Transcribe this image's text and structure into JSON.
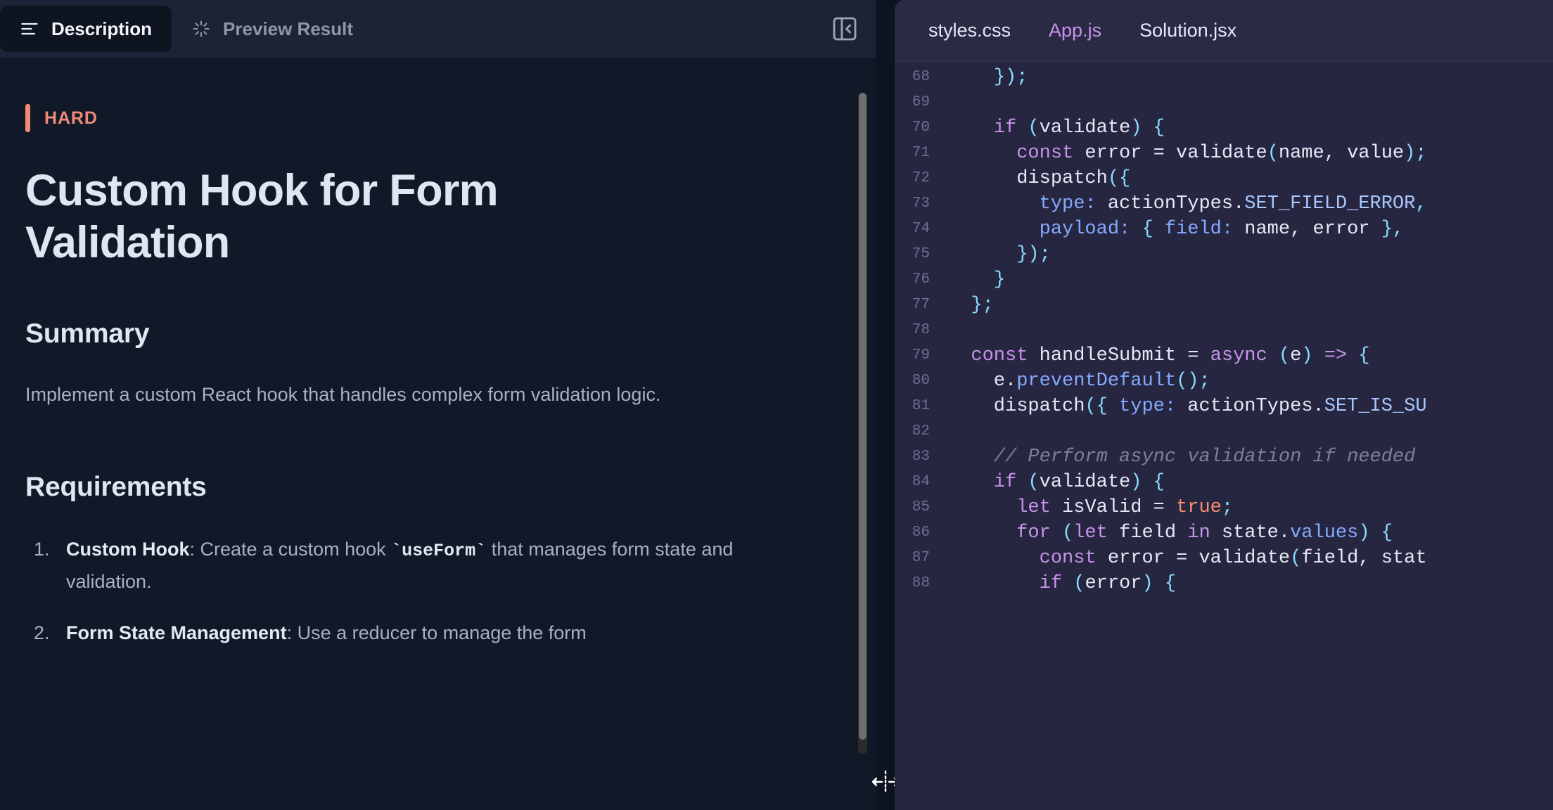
{
  "left_panel": {
    "tabs": [
      {
        "label": "Description",
        "icon": "align-left-icon",
        "active": true
      },
      {
        "label": "Preview Result",
        "icon": "sparkle-wand-icon",
        "active": false
      }
    ],
    "collapse_icon": "panel-collapse-left-icon",
    "difficulty_badge": "HARD",
    "difficulty_color": "#f08a77",
    "title": "Custom Hook for Form Validation",
    "summary_heading": "Summary",
    "summary_text": "Implement a custom React hook that handles complex form validation logic.",
    "requirements_heading": "Requirements",
    "requirements": [
      {
        "number": "1.",
        "term": "Custom Hook",
        "sep": ": ",
        "text_before": "Create a custom hook ",
        "code": "`useForm`",
        "text_after": " that manages form state and validation."
      },
      {
        "number": "2.",
        "term": "Form State Management",
        "sep": ": ",
        "text_before": "Use a reducer to manage the form",
        "code": "",
        "text_after": ""
      }
    ]
  },
  "splitter": {
    "cursor_icon": "horizontal-resize-cursor"
  },
  "right_panel": {
    "tabs": [
      {
        "label": "styles.css",
        "active": false
      },
      {
        "label": "App.js",
        "active": true
      },
      {
        "label": "Solution.jsx",
        "active": false
      }
    ],
    "active_tab_color": "#c792ea",
    "code_lines": [
      {
        "num": "68",
        "tokens": [
          {
            "t": "    ",
            "c": "tk-var"
          },
          {
            "t": "});",
            "c": "tk-punc"
          }
        ]
      },
      {
        "num": "69",
        "tokens": [
          {
            "t": "",
            "c": "tk-var"
          }
        ]
      },
      {
        "num": "70",
        "tokens": [
          {
            "t": "    ",
            "c": "tk-var"
          },
          {
            "t": "if",
            "c": "tk-kw"
          },
          {
            "t": " ",
            "c": "tk-var"
          },
          {
            "t": "(",
            "c": "tk-punc"
          },
          {
            "t": "validate",
            "c": "tk-var"
          },
          {
            "t": ")",
            "c": "tk-punc"
          },
          {
            "t": " ",
            "c": "tk-var"
          },
          {
            "t": "{",
            "c": "tk-punc"
          }
        ]
      },
      {
        "num": "71",
        "tokens": [
          {
            "t": "      ",
            "c": "tk-var"
          },
          {
            "t": "const",
            "c": "tk-kw"
          },
          {
            "t": " error = validate",
            "c": "tk-var"
          },
          {
            "t": "(",
            "c": "tk-punc"
          },
          {
            "t": "name, value",
            "c": "tk-var"
          },
          {
            "t": ");",
            "c": "tk-punc"
          }
        ]
      },
      {
        "num": "72",
        "tokens": [
          {
            "t": "      dispatch",
            "c": "tk-var"
          },
          {
            "t": "({",
            "c": "tk-punc"
          }
        ]
      },
      {
        "num": "73",
        "tokens": [
          {
            "t": "        ",
            "c": "tk-var"
          },
          {
            "t": "type:",
            "c": "tk-prop"
          },
          {
            "t": " actionTypes.",
            "c": "tk-var"
          },
          {
            "t": "SET_FIELD_ERROR",
            "c": "tk-cap"
          },
          {
            "t": ",",
            "c": "tk-punc"
          }
        ]
      },
      {
        "num": "74",
        "tokens": [
          {
            "t": "        ",
            "c": "tk-var"
          },
          {
            "t": "payload:",
            "c": "tk-prop"
          },
          {
            "t": " ",
            "c": "tk-var"
          },
          {
            "t": "{",
            "c": "tk-punc"
          },
          {
            "t": " ",
            "c": "tk-var"
          },
          {
            "t": "field:",
            "c": "tk-prop"
          },
          {
            "t": " name, error ",
            "c": "tk-var"
          },
          {
            "t": "},",
            "c": "tk-punc"
          }
        ]
      },
      {
        "num": "75",
        "tokens": [
          {
            "t": "      ",
            "c": "tk-var"
          },
          {
            "t": "});",
            "c": "tk-punc"
          }
        ]
      },
      {
        "num": "76",
        "tokens": [
          {
            "t": "    ",
            "c": "tk-var"
          },
          {
            "t": "}",
            "c": "tk-punc"
          }
        ]
      },
      {
        "num": "77",
        "tokens": [
          {
            "t": "  ",
            "c": "tk-var"
          },
          {
            "t": "};",
            "c": "tk-punc"
          }
        ]
      },
      {
        "num": "78",
        "tokens": [
          {
            "t": "",
            "c": "tk-var"
          }
        ]
      },
      {
        "num": "79",
        "tokens": [
          {
            "t": "  ",
            "c": "tk-var"
          },
          {
            "t": "const",
            "c": "tk-kw"
          },
          {
            "t": " handleSubmit = ",
            "c": "tk-var"
          },
          {
            "t": "async",
            "c": "tk-kw"
          },
          {
            "t": " ",
            "c": "tk-var"
          },
          {
            "t": "(",
            "c": "tk-punc"
          },
          {
            "t": "e",
            "c": "tk-var"
          },
          {
            "t": ")",
            "c": "tk-punc"
          },
          {
            "t": " ",
            "c": "tk-var"
          },
          {
            "t": "=>",
            "c": "tk-kw"
          },
          {
            "t": " ",
            "c": "tk-var"
          },
          {
            "t": "{",
            "c": "tk-punc"
          }
        ]
      },
      {
        "num": "80",
        "tokens": [
          {
            "t": "    e.",
            "c": "tk-var"
          },
          {
            "t": "preventDefault",
            "c": "tk-fn"
          },
          {
            "t": "();",
            "c": "tk-punc"
          }
        ]
      },
      {
        "num": "81",
        "tokens": [
          {
            "t": "    dispatch",
            "c": "tk-var"
          },
          {
            "t": "({",
            "c": "tk-punc"
          },
          {
            "t": " ",
            "c": "tk-var"
          },
          {
            "t": "type:",
            "c": "tk-prop"
          },
          {
            "t": " actionTypes.",
            "c": "tk-var"
          },
          {
            "t": "SET_IS_SU",
            "c": "tk-cap"
          }
        ]
      },
      {
        "num": "82",
        "tokens": [
          {
            "t": "",
            "c": "tk-var"
          }
        ]
      },
      {
        "num": "83",
        "tokens": [
          {
            "t": "    ",
            "c": "tk-var"
          },
          {
            "t": "// Perform async validation if needed",
            "c": "tk-com"
          }
        ]
      },
      {
        "num": "84",
        "tokens": [
          {
            "t": "    ",
            "c": "tk-var"
          },
          {
            "t": "if",
            "c": "tk-kw"
          },
          {
            "t": " ",
            "c": "tk-var"
          },
          {
            "t": "(",
            "c": "tk-punc"
          },
          {
            "t": "validate",
            "c": "tk-var"
          },
          {
            "t": ")",
            "c": "tk-punc"
          },
          {
            "t": " ",
            "c": "tk-var"
          },
          {
            "t": "{",
            "c": "tk-punc"
          }
        ]
      },
      {
        "num": "85",
        "tokens": [
          {
            "t": "      ",
            "c": "tk-var"
          },
          {
            "t": "let",
            "c": "tk-kw"
          },
          {
            "t": " isValid = ",
            "c": "tk-var"
          },
          {
            "t": "true",
            "c": "tk-const"
          },
          {
            "t": ";",
            "c": "tk-punc"
          }
        ]
      },
      {
        "num": "86",
        "tokens": [
          {
            "t": "      ",
            "c": "tk-var"
          },
          {
            "t": "for",
            "c": "tk-kw"
          },
          {
            "t": " ",
            "c": "tk-var"
          },
          {
            "t": "(",
            "c": "tk-punc"
          },
          {
            "t": "let",
            "c": "tk-kw"
          },
          {
            "t": " field ",
            "c": "tk-var"
          },
          {
            "t": "in",
            "c": "tk-kw"
          },
          {
            "t": " state.",
            "c": "tk-var"
          },
          {
            "t": "values",
            "c": "tk-fn"
          },
          {
            "t": ")",
            "c": "tk-punc"
          },
          {
            "t": " ",
            "c": "tk-var"
          },
          {
            "t": "{",
            "c": "tk-punc"
          }
        ]
      },
      {
        "num": "87",
        "tokens": [
          {
            "t": "        ",
            "c": "tk-var"
          },
          {
            "t": "const",
            "c": "tk-kw"
          },
          {
            "t": " error = validate",
            "c": "tk-var"
          },
          {
            "t": "(",
            "c": "tk-punc"
          },
          {
            "t": "field, stat",
            "c": "tk-var"
          }
        ]
      },
      {
        "num": "88",
        "tokens": [
          {
            "t": "        ",
            "c": "tk-var"
          },
          {
            "t": "if",
            "c": "tk-kw"
          },
          {
            "t": " ",
            "c": "tk-var"
          },
          {
            "t": "(",
            "c": "tk-punc"
          },
          {
            "t": "error",
            "c": "tk-var"
          },
          {
            "t": ")",
            "c": "tk-punc"
          },
          {
            "t": " ",
            "c": "tk-var"
          },
          {
            "t": "{",
            "c": "tk-punc"
          }
        ]
      }
    ]
  }
}
